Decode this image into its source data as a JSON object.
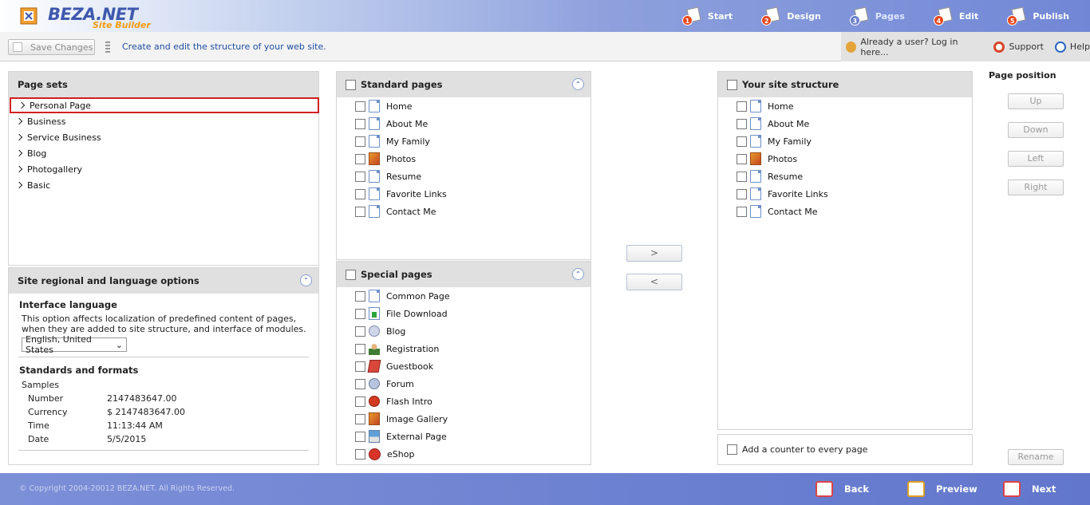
{
  "brand": {
    "name": "BEZA.NET",
    "sub": "Site Builder"
  },
  "steps": [
    {
      "num": "1",
      "label": "Start"
    },
    {
      "num": "2",
      "label": "Design"
    },
    {
      "num": "3",
      "label": "Pages"
    },
    {
      "num": "4",
      "label": "Edit"
    },
    {
      "num": "5",
      "label": "Publish"
    }
  ],
  "toolbar": {
    "save_label": "Save Changes",
    "description": "Create and edit the structure of your web site.",
    "login": "Already a user? Log in here...",
    "support": "Support",
    "help": "Help"
  },
  "page_sets": {
    "title": "Page sets",
    "items": [
      "Personal Page",
      "Business",
      "Service Business",
      "Blog",
      "Photogallery",
      "Basic"
    ],
    "selected": "Personal Page"
  },
  "regional": {
    "title": "Site regional and language options",
    "interface_language": "Interface language",
    "description": "This option affects localization of predefined content of pages, when they are added to site structure, and interface of modules.",
    "language_value": "English, United States",
    "standards_title": "Standards and formats",
    "samples": "Samples",
    "formats": [
      {
        "label": "Number",
        "value": "2147483647.00"
      },
      {
        "label": "Currency",
        "value": "$ 2147483647.00"
      },
      {
        "label": "Time",
        "value": "11:13:44 AM"
      },
      {
        "label": "Date",
        "value": "5/5/2015"
      }
    ]
  },
  "standard_pages": {
    "title": "Standard pages",
    "items": [
      {
        "label": "Home",
        "icon": "document-icon"
      },
      {
        "label": "About Me",
        "icon": "document-icon"
      },
      {
        "label": "My Family",
        "icon": "document-icon"
      },
      {
        "label": "Photos",
        "icon": "photo-icon"
      },
      {
        "label": "Resume",
        "icon": "document-icon"
      },
      {
        "label": "Favorite Links",
        "icon": "document-icon"
      },
      {
        "label": "Contact Me",
        "icon": "document-icon"
      }
    ]
  },
  "special_pages": {
    "title": "Special pages",
    "items": [
      {
        "label": "Common Page",
        "icon": "document-icon"
      },
      {
        "label": "File Download",
        "icon": "download-icon"
      },
      {
        "label": "Blog",
        "icon": "blog-icon"
      },
      {
        "label": "Registration",
        "icon": "registration-icon"
      },
      {
        "label": "Guestbook",
        "icon": "guestbook-icon"
      },
      {
        "label": "Forum",
        "icon": "forum-icon"
      },
      {
        "label": "Flash Intro",
        "icon": "flash-icon"
      },
      {
        "label": "Image Gallery",
        "icon": "photo-icon"
      },
      {
        "label": "External Page",
        "icon": "external-page-icon"
      },
      {
        "label": "eShop",
        "icon": "eshop-icon"
      }
    ]
  },
  "move": {
    "add": ">",
    "remove": "<"
  },
  "site_structure": {
    "title": "Your site structure",
    "items": [
      {
        "label": "Home",
        "icon": "document-icon"
      },
      {
        "label": "About Me",
        "icon": "document-icon"
      },
      {
        "label": "My Family",
        "icon": "document-icon"
      },
      {
        "label": "Photos",
        "icon": "photo-icon"
      },
      {
        "label": "Resume",
        "icon": "document-icon"
      },
      {
        "label": "Favorite Links",
        "icon": "document-icon"
      },
      {
        "label": "Contact Me",
        "icon": "document-icon"
      }
    ],
    "counter_label": "Add a counter to every page"
  },
  "page_position": {
    "title": "Page position",
    "up": "Up",
    "down": "Down",
    "left": "Left",
    "right": "Right",
    "rename": "Rename"
  },
  "footer": {
    "copyright": "© Copyright 2004-20012 BEZA.NET. All Rights Reserved.",
    "back": "Back",
    "preview": "Preview",
    "next": "Next"
  },
  "colors": {
    "accent": "#6c80d1",
    "selection": "#d21f1f",
    "link": "#1d4c9e"
  }
}
